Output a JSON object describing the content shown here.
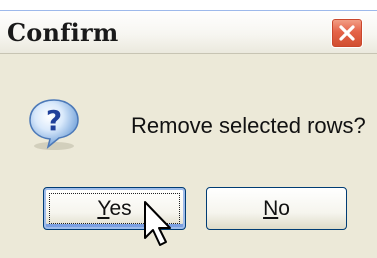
{
  "dialog": {
    "title": "Confirm",
    "message": "Remove selected rows?",
    "icon": "question-icon",
    "buttons": {
      "yes": {
        "mnemonic": "Y",
        "rest": "es",
        "label": "Yes",
        "focused": true
      },
      "no": {
        "mnemonic": "N",
        "rest": "o",
        "label": "No"
      }
    },
    "close_icon": "close-icon"
  },
  "colors": {
    "dialog_background": "#ece9d8",
    "close_button": "#e5644a",
    "button_border": "#003c74",
    "focus_ring": "#7a9fe2"
  }
}
